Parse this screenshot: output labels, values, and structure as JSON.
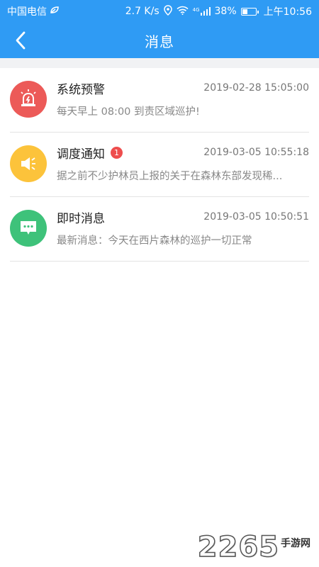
{
  "status_bar": {
    "carrier": "中国电信",
    "speed": "2.7 K/s",
    "network": "4G",
    "battery": "38%",
    "time": "上午10:56"
  },
  "header": {
    "title": "消息",
    "bg_color": "#2f9bf4"
  },
  "messages": [
    {
      "title": "系统预警",
      "time": "2019-02-28 15:05:00",
      "preview": "每天早上 08:00 到责区域巡护!",
      "icon": "alarm-light-icon",
      "icon_color": "#ec5a58",
      "badge": ""
    },
    {
      "title": "调度通知",
      "time": "2019-03-05 10:55:18",
      "preview": "据之前不少护林员上报的关于在森林东部发现稀...",
      "icon": "speaker-icon",
      "icon_color": "#fcc33b",
      "badge": "1"
    },
    {
      "title": "即时消息",
      "time": "2019-03-05 10:50:51",
      "preview": "最新消息：今天在西片森林的巡护一切正常",
      "icon": "chat-bubble-icon",
      "icon_color": "#3ec27a",
      "badge": ""
    }
  ],
  "watermark": {
    "number": "2265",
    "text": "手游网"
  }
}
